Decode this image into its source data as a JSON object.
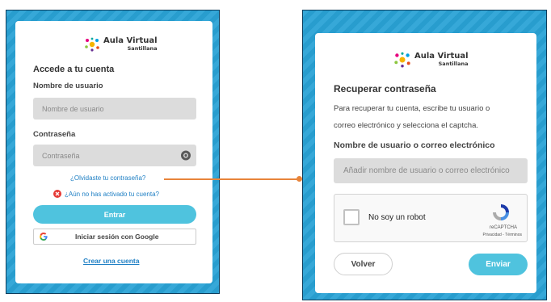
{
  "login": {
    "logo": {
      "main": "Aula Virtual",
      "sub": "Santillana"
    },
    "title": "Accede a tu cuenta",
    "username_label": "Nombre de usuario",
    "username_placeholder": "Nombre de usuario",
    "password_label": "Contraseña",
    "password_placeholder": "Contraseña",
    "forgot_link": "¿Olvidaste tu contraseña?",
    "not_activated_link": "¿Aún no has activado tu cuenta?",
    "submit_label": "Entrar",
    "google_label": "Iniciar sesión con Google",
    "create_account_link": "Crear una cuenta"
  },
  "recover": {
    "logo": {
      "main": "Aula Virtual",
      "sub": "Santillana"
    },
    "title": "Recuperar contraseña",
    "instructions_line1": "Para recuperar tu cuenta, escribe tu usuario o",
    "instructions_line2": "correo electrónico y selecciona el captcha.",
    "field_label": "Nombre de usuario o correo electrónico",
    "field_placeholder": "Añadir nombre de usuario o correo electrónico",
    "captcha": {
      "label": "No soy un robot",
      "brand": "reCAPTCHA",
      "terms": "Privacidad - Términos"
    },
    "back_label": "Volver",
    "send_label": "Enviar"
  },
  "colors": {
    "frame": "#2aa3d6",
    "accent": "#4fc3de",
    "link": "#1e7fc4",
    "connector": "#e8843a",
    "error": "#e53935"
  },
  "icons": [
    "aula-virtual-logo-icon",
    "eye-icon",
    "error-circle-icon",
    "google-g-icon",
    "recaptcha-icon"
  ]
}
